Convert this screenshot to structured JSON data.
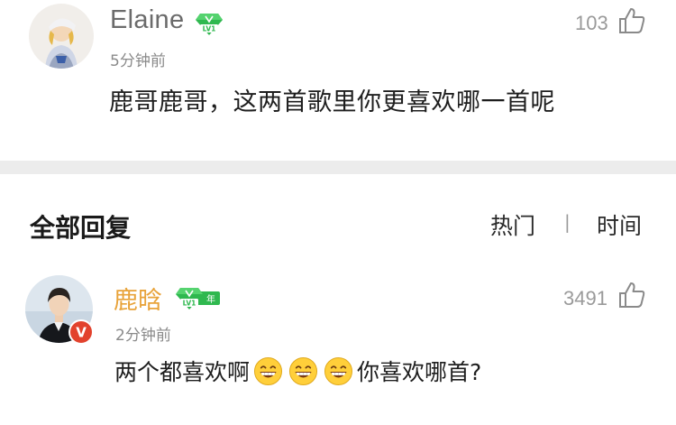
{
  "top_comment": {
    "username": "Elaine",
    "time": "5分钟前",
    "text": "鹿哥鹿哥，这两首歌里你更喜欢哪一首呢",
    "likes": "103",
    "level_badge": "LV1"
  },
  "replies_section": {
    "title": "全部回复",
    "sort_hot": "热门",
    "sort_separator": "|",
    "sort_time": "时间"
  },
  "reply": {
    "username": "鹿晗",
    "time": "2分钟前",
    "text_before": "两个都喜欢啊",
    "emoji_name": "grinning-face-icon",
    "emoji_count": 3,
    "text_after": "你喜欢哪首?",
    "likes": "3491",
    "level_badge": "LV1",
    "year_badge": "年",
    "verified_badge": "V"
  },
  "colors": {
    "username_gray": "#6b6b6b",
    "username_gold": "#e8a33a",
    "badge_green": "#2fb84f",
    "verified_red": "#e2422d",
    "divider": "#ececec"
  }
}
